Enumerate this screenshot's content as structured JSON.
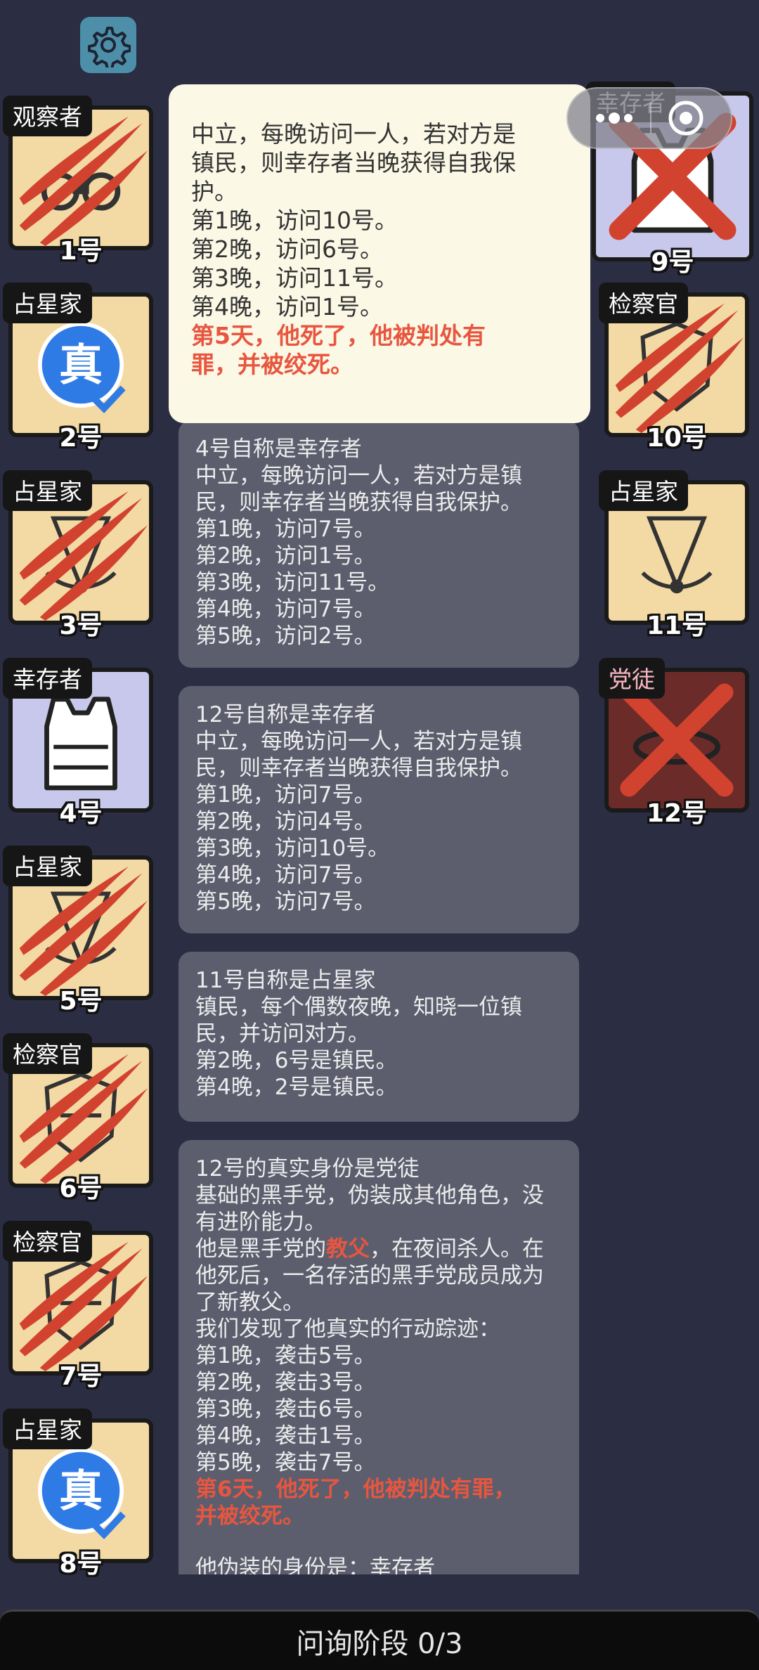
{
  "tooltip": {
    "lines": [
      "中立，每晚访问一人，若对方是",
      "镇民，则幸存者当晚获得自我保",
      "护。",
      "第1晚，访问10号。",
      "第2晚，访问6号。",
      "第3晚，访问11号。",
      "第4晚，访问1号。"
    ],
    "death_lines": [
      "第5天，他死了，他被判处有",
      "罪，并被绞死。"
    ]
  },
  "left_players": [
    {
      "role": "观察者",
      "num": "1号"
    },
    {
      "role": "占星家",
      "num": "2号"
    },
    {
      "role": "占星家",
      "num": "3号"
    },
    {
      "role": "幸存者",
      "num": "4号"
    },
    {
      "role": "占星家",
      "num": "5号"
    },
    {
      "role": "检察官",
      "num": "6号"
    },
    {
      "role": "检察官",
      "num": "7号"
    },
    {
      "role": "占星家",
      "num": "8号"
    }
  ],
  "right_players": [
    {
      "role": "幸存者",
      "num": "9号"
    },
    {
      "role": "检察官",
      "num": "10号"
    },
    {
      "role": "占星家",
      "num": "11号"
    },
    {
      "role": "党徒",
      "num": "12号"
    }
  ],
  "badges": {
    "true_label": "真"
  },
  "panels": [
    {
      "lines": [
        "4号自称是幸存者",
        "中立，每晚访问一人，若对方是镇",
        "民，则幸存者当晚获得自我保护。",
        "第1晚，访问7号。",
        "第2晚，访问1号。",
        "第3晚，访问11号。",
        "第4晚，访问7号。",
        "第5晚，访问2号。"
      ]
    },
    {
      "lines": [
        "12号自称是幸存者",
        "中立，每晚访问一人，若对方是镇",
        "民，则幸存者当晚获得自我保护。",
        "第1晚，访问7号。",
        "第2晚，访问4号。",
        "第3晚，访问10号。",
        "第4晚，访问7号。",
        "第5晚，访问7号。"
      ]
    },
    {
      "lines": [
        "11号自称是占星家",
        "镇民，每个偶数夜晚，知晓一位镇",
        "民，并访问对方。",
        "第2晚，6号是镇民。",
        "第4晚，2号是镇民。"
      ]
    },
    {
      "lines_a": [
        "12号的真实身份是党徒",
        "基础的黑手党，伪装成其他角色，没",
        "有进阶能力。"
      ],
      "godfather_pre": "他是黑手党的",
      "godfather_word": "教父",
      "godfather_post": "，在夜间杀人。在",
      "lines_b": [
        "他死后，一名存活的黑手党成员成为",
        "了新教父。",
        "我们发现了他真实的行动踪迹：",
        "第1晚，袭击5号。",
        "第2晚，袭击3号。",
        "第3晚，袭击6号。",
        "第4晚，袭击1号。",
        "第5晚，袭击7号。"
      ],
      "death_lines": [
        "第6天，他死了，他被判处有罪，",
        "并被绞死。"
      ],
      "disguise": "他伪装的身份是：幸存者"
    }
  ],
  "footer": {
    "label": "问询阶段 0/3"
  },
  "colors": {
    "background": "#2b2d42",
    "card_cream": "#f3d9a4",
    "card_lavender": "#c8c8ec",
    "card_red": "#6b2b28",
    "death_red": "#e8563f",
    "true_blue": "#2f7be6"
  },
  "icons": [
    "gear-icon",
    "more-dots-icon",
    "close-circle-icon",
    "claw-mark-icon",
    "x-mark-icon",
    "true-badge-icon"
  ]
}
